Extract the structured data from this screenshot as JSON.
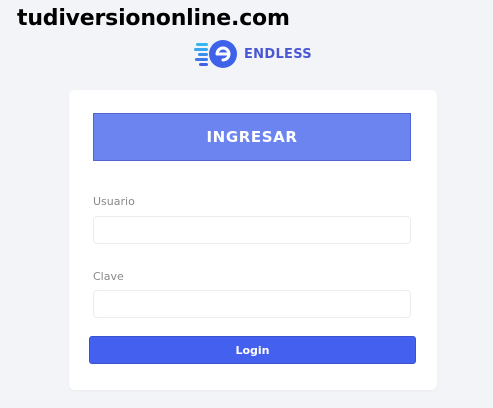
{
  "watermark": "tudiversiononline.com",
  "brand": {
    "name": "ENDLESS",
    "logo_icon": "endless-e-logo-icon",
    "accent_color": "#4a57d3"
  },
  "login_card": {
    "header_label": "INGRESAR",
    "header_color": "#6c84f0",
    "fields": [
      {
        "label": "Usuario",
        "value": "",
        "placeholder": ""
      },
      {
        "label": "Clave",
        "value": "",
        "placeholder": ""
      }
    ],
    "submit_label": "Login",
    "submit_color": "#4460ef"
  }
}
